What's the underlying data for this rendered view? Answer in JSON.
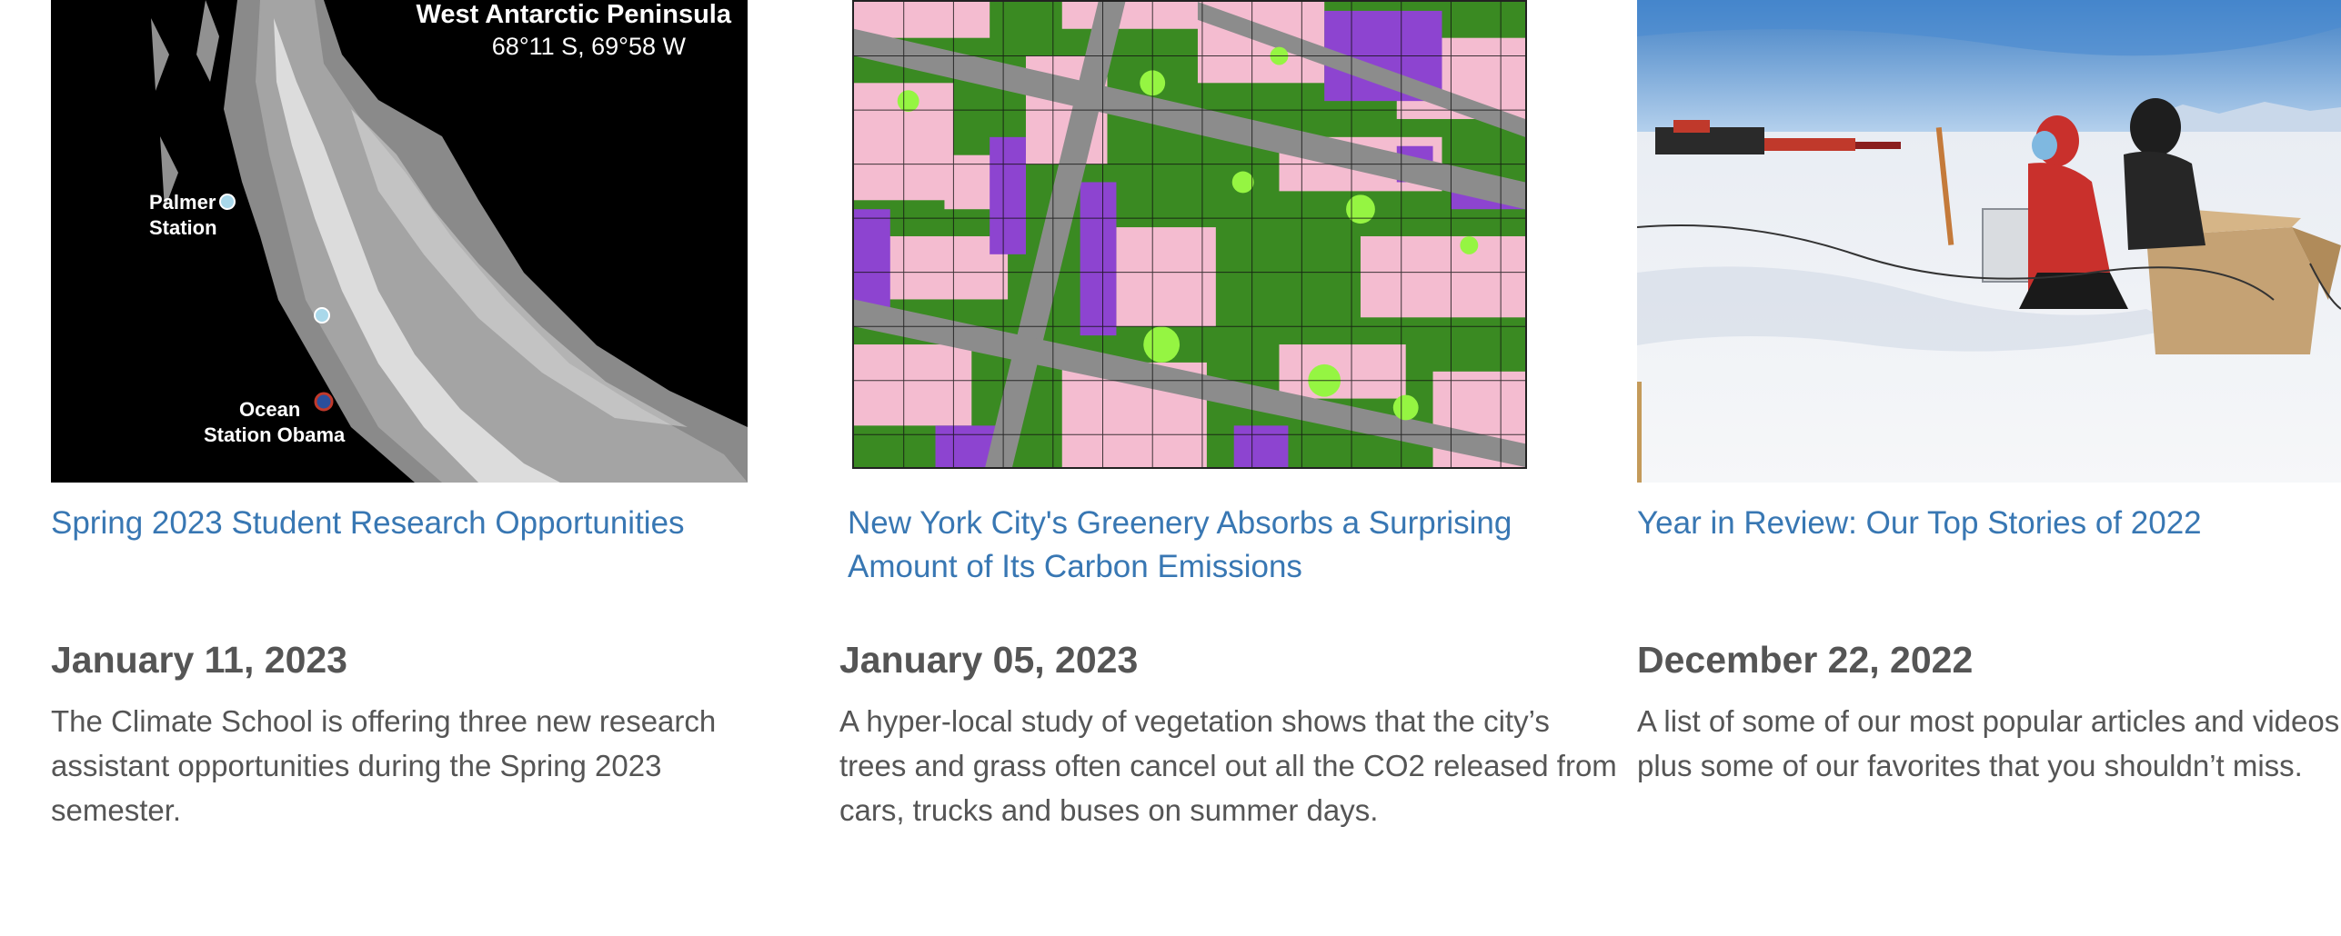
{
  "cards": [
    {
      "image": {
        "alt": "Map of the West Antarctic Peninsula",
        "map_title": "West Antarctic Peninsula",
        "map_coords": "68°11 S, 69°58 W",
        "labels": [
          "Palmer",
          "Station",
          "Ocean",
          "Station Obama"
        ]
      },
      "title_lines": [
        "Spring 2023 Student Research Opportunities"
      ],
      "date": "January 11, 2023",
      "desc_lines": [
        "The Climate School is offering three new research",
        "assistant opportunities during the Spring 2023",
        "semester."
      ]
    },
    {
      "image": {
        "alt": "Gridded land-cover map of New York City blocks showing trees, grass and buildings"
      },
      "title_lines": [
        "New York City's Greenery Absorbs a Surprising",
        "Amount of Its Carbon Emissions"
      ],
      "date": "January 05, 2023",
      "desc_lines": [
        "A hyper-local study of vegetation shows that the city’s",
        "trees and grass often cancel out all the CO2 released from",
        "cars, trucks and buses on summer days."
      ]
    },
    {
      "image": {
        "alt": "Two researchers working at a field station on Antarctic snow"
      },
      "title_lines": [
        "Year in Review: Our Top Stories of 2022"
      ],
      "date": "December 22, 2022",
      "desc_lines": [
        "A list of some of our most popular articles and videos,",
        "plus some of our favorites that you shouldn’t miss."
      ]
    }
  ],
  "colors": {
    "link": "#3877b3",
    "text": "#555555",
    "map_bg": "#000000",
    "tree": "#3a8a22",
    "grass": "#95f542",
    "building": "#f4bcd0",
    "road": "#8c8c8c",
    "impervious": "#8d44d0"
  }
}
